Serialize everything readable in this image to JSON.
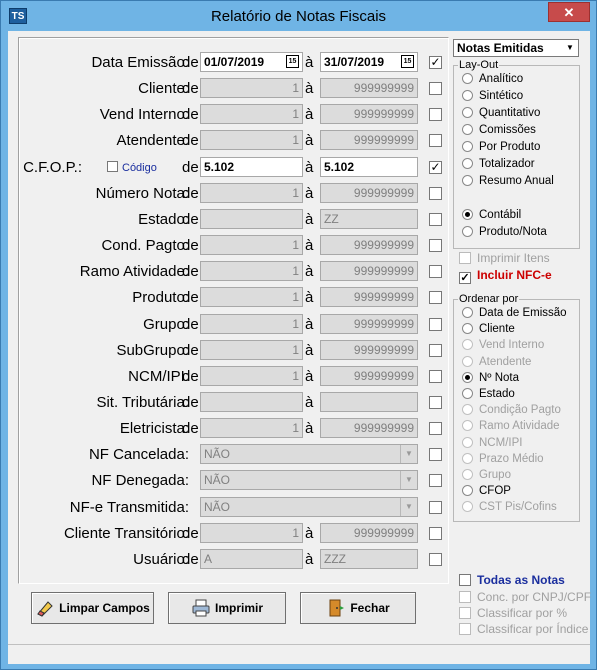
{
  "window": {
    "title": "Relatório de Notas Fiscais",
    "icon_text": "TS",
    "close": "✕"
  },
  "fields": [
    {
      "label": "Data Emissão:",
      "de": "de",
      "a": "à",
      "from": "01/07/2019",
      "to": "31/07/2019",
      "date_icon": "15",
      "checked": true,
      "active": true
    },
    {
      "label": "Cliente:",
      "de": "de",
      "a": "à",
      "from": "1",
      "to": "999999999",
      "checked": false
    },
    {
      "label": "Vend Interno:",
      "de": "de",
      "a": "à",
      "from": "1",
      "to": "999999999",
      "checked": false
    },
    {
      "label": "Atendente:",
      "de": "de",
      "a": "à",
      "from": "1",
      "to": "999999999",
      "checked": false
    },
    {
      "label": "C.F.O.P.:",
      "de": "de",
      "a": "à",
      "from": "5.102",
      "to": "5.102",
      "checked": true,
      "active": true,
      "codigo": "Código"
    },
    {
      "label": "Número Nota:",
      "de": "de",
      "a": "à",
      "from": "1",
      "to": "999999999",
      "checked": false
    },
    {
      "label": "Estado:",
      "de": "de",
      "a": "à",
      "from": "",
      "to": "ZZ",
      "checked": false
    },
    {
      "label": "Cond. Pagto:",
      "de": "de",
      "a": "à",
      "from": "1",
      "to": "999999999",
      "checked": false
    },
    {
      "label": "Ramo Atividade:",
      "de": "de",
      "a": "à",
      "from": "1",
      "to": "999999999",
      "checked": false
    },
    {
      "label": "Produto:",
      "de": "de",
      "a": "à",
      "from": "1",
      "to": "999999999",
      "checked": false
    },
    {
      "label": "Grupo:",
      "de": "de",
      "a": "à",
      "from": "1",
      "to": "999999999",
      "checked": false
    },
    {
      "label": "SubGrupo:",
      "de": "de",
      "a": "à",
      "from": "1",
      "to": "999999999",
      "checked": false
    },
    {
      "label": "NCM/IPI:",
      "de": "de",
      "a": "à",
      "from": "1",
      "to": "999999999",
      "checked": false
    },
    {
      "label": "Sit. Tributária:",
      "de": "de",
      "a": "à",
      "from": "",
      "to": "",
      "checked": false
    },
    {
      "label": "Eletricista:",
      "de": "de",
      "a": "à",
      "from": "1",
      "to": "999999999",
      "checked": false
    }
  ],
  "selects": [
    {
      "label": "NF Cancelada:",
      "value": "NÃO"
    },
    {
      "label": "NF Denegada:",
      "value": "NÃO"
    },
    {
      "label": "NF-e Transmitida:",
      "value": "NÃO"
    }
  ],
  "fields2": [
    {
      "label": "Cliente Transitório:",
      "de": "de",
      "a": "à",
      "from": "1",
      "to": "999999999"
    },
    {
      "label": "Usuário:",
      "de": "de",
      "a": "à",
      "from": "A",
      "to": "ZZZ"
    }
  ],
  "buttons": {
    "limpar": "Limpar Campos",
    "imprimir": "Imprimir",
    "fechar": "Fechar"
  },
  "right": {
    "combo": "Notas Emitidas",
    "layout_title": "Lay-Out",
    "layout_options": [
      "Analítico",
      "Sintético",
      "Quantitativo",
      "Comissões",
      "Por Produto",
      "Totalizador",
      "Resumo Anual"
    ],
    "contabil_options": [
      "Contábil",
      "Produto/Nota"
    ],
    "imprimir_itens": "Imprimir Itens",
    "incluir_nfce": "Incluir NFC-e",
    "ordenar_title": "Ordenar por",
    "ordenar_options": [
      {
        "label": "Data de Emissão",
        "enabled": true
      },
      {
        "label": "Cliente",
        "enabled": true
      },
      {
        "label": "Vend Interno",
        "enabled": false
      },
      {
        "label": "Atendente",
        "enabled": false
      },
      {
        "label": "Nº Nota",
        "enabled": true,
        "selected": true
      },
      {
        "label": "Estado",
        "enabled": true
      },
      {
        "label": "Condição Pagto",
        "enabled": false
      },
      {
        "label": "Ramo Atividade",
        "enabled": false
      },
      {
        "label": "NCM/IPI",
        "enabled": false
      },
      {
        "label": "Prazo Médio",
        "enabled": false
      },
      {
        "label": "Grupo",
        "enabled": false
      },
      {
        "label": "CFOP",
        "enabled": true
      },
      {
        "label": "CST Pis/Cofins",
        "enabled": false
      }
    ],
    "todas_notas": "Todas as Notas",
    "conc_cnpj": "Conc. por CNPJ/CPF",
    "classificar_pct": "Classificar por %",
    "classificar_indice": "Classificar por Índice"
  },
  "colors": {
    "title_bar": "#6fb4e5",
    "close": "#c74b4b",
    "incluir_nfce": "#cc0000",
    "todas_notas": "#1a2e9e"
  }
}
